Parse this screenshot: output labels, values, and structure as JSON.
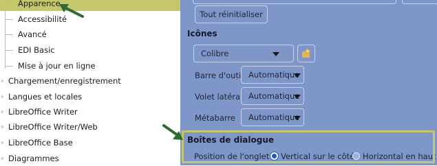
{
  "tree": {
    "children": [
      {
        "label": "Apparence",
        "selected": true
      },
      {
        "label": "Accessibilité",
        "selected": false
      },
      {
        "label": "Avancé",
        "selected": false
      },
      {
        "label": "EDI Basic",
        "selected": false
      },
      {
        "label": "Mise à jour en ligne",
        "selected": false
      }
    ],
    "top_items": [
      "Chargement/enregistrement",
      "Langues et locales",
      "LibreOffice Writer",
      "LibreOffice Writer/Web",
      "LibreOffice Base",
      "Diagrammes"
    ]
  },
  "panel": {
    "reset_button": "Tout réinitialiser",
    "icons_heading": "Icônes",
    "icon_theme": "Colibre",
    "toolbar_label": "Barre d'outils",
    "toolbar_value": "Automatique",
    "sidebar_label": "Volet latéral",
    "sidebar_value": "Automatique",
    "menubar_label": "Métabarre",
    "menubar_value": "Automatique",
    "dialogs_heading": "Boîtes de dialogue",
    "tab_position_label": "Position de l'onglet :",
    "tab_options": [
      {
        "label": "Vertical sur le côté",
        "selected": true
      },
      {
        "label": "Horizontal en haut",
        "selected": false
      }
    ]
  },
  "colors": {
    "panel_bg": "#7f96c9",
    "selection_highlight": "#c5c86a",
    "annotation_arrow": "#2e6b2e"
  },
  "icons": {
    "dropdown": "chevron-down-icon",
    "extension": "star-puzzle-icon",
    "annotation": "arrow-icon"
  }
}
